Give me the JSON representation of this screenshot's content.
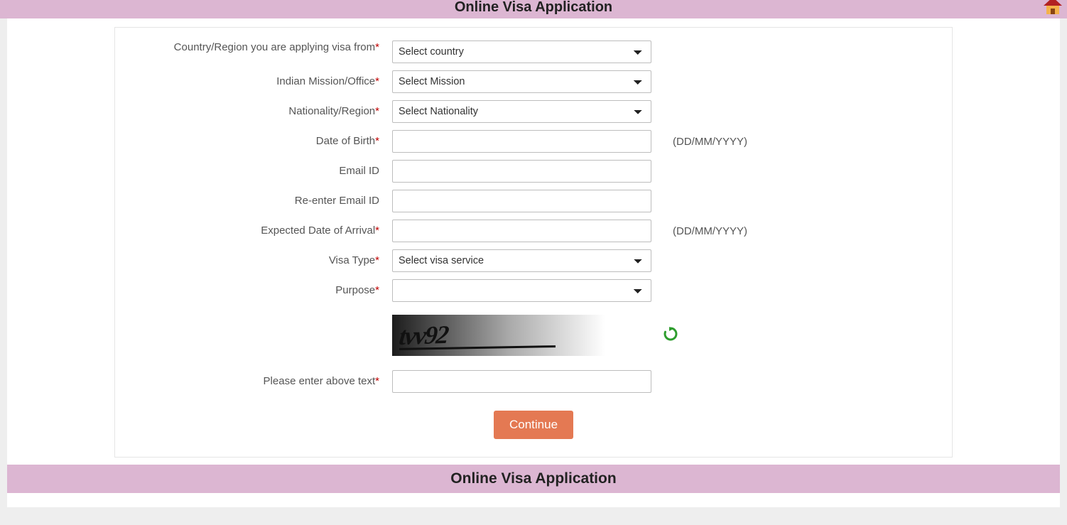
{
  "header": {
    "title": "Online Visa Application"
  },
  "footer": {
    "title": "Online Visa Application"
  },
  "form": {
    "country": {
      "label": "Country/Region you are applying visa from",
      "required": "*",
      "selected": "Select country"
    },
    "mission": {
      "label": "Indian Mission/Office",
      "required": "*",
      "selected": "Select Mission"
    },
    "nationality": {
      "label": "Nationality/Region",
      "required": "*",
      "selected": "Select Nationality"
    },
    "dob": {
      "label": "Date of Birth",
      "required": "*",
      "value": "",
      "hint": "(DD/MM/YYYY)"
    },
    "email": {
      "label": "Email ID",
      "value": ""
    },
    "reemail": {
      "label": "Re-enter Email ID",
      "value": ""
    },
    "arrival": {
      "label": "Expected Date of Arrival",
      "required": "*",
      "value": "",
      "hint": "(DD/MM/YYYY)"
    },
    "visatype": {
      "label": "Visa Type",
      "required": "*",
      "selected": "Select visa service"
    },
    "purpose": {
      "label": "Purpose",
      "required": "*",
      "selected": ""
    },
    "captcha": {
      "image_text": "tvv92",
      "label": "Please enter above text",
      "required": "*",
      "value": ""
    },
    "submit": {
      "label": "Continue"
    }
  }
}
